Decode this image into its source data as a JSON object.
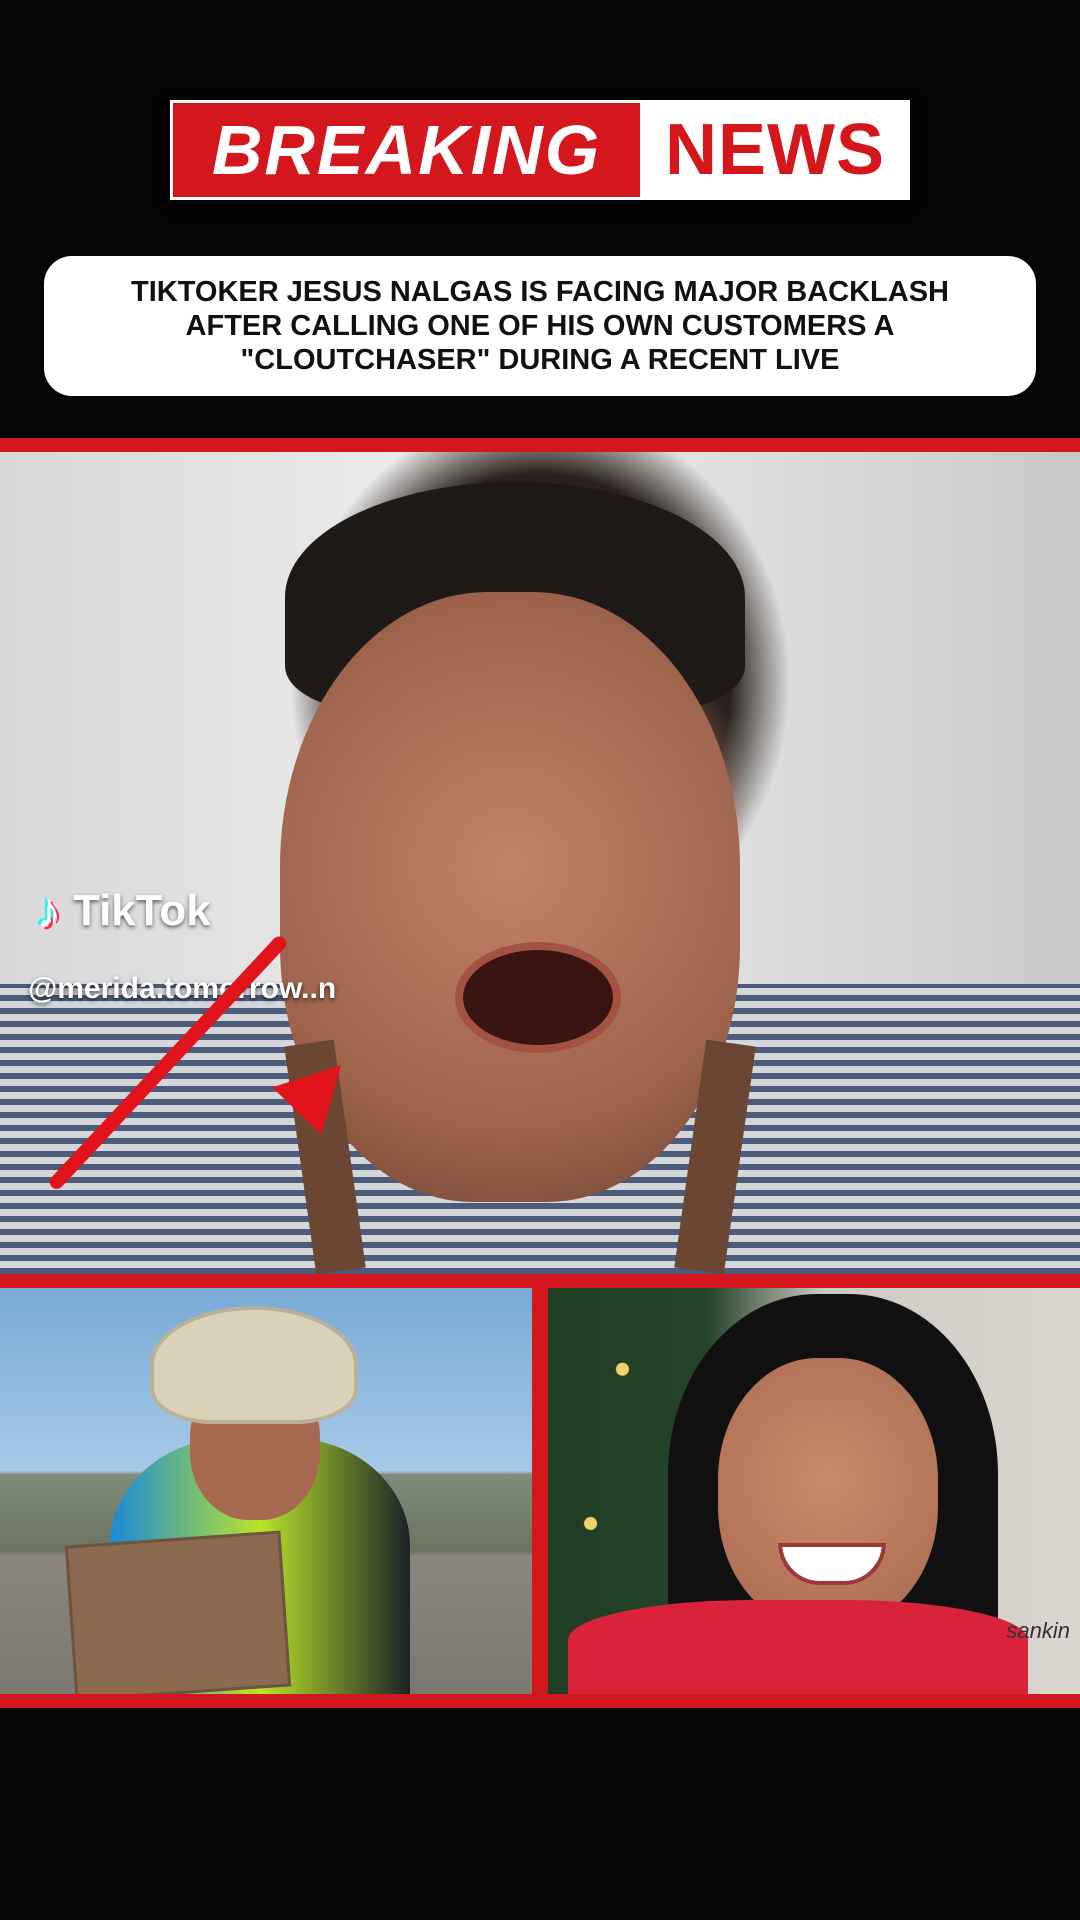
{
  "banner": {
    "left": "BREAKING",
    "right": "NEWS"
  },
  "headline": "TIKTOKER JESUS NALGAS IS FACING MAJOR BACKLASH\nAFTER CALLING ONE OF HIS OWN CUSTOMERS A\n\"CLOUTCHASER\" DURING A RECENT LIVE",
  "watermark": {
    "brand": "TikTok",
    "handle": "@merida.tomorrow..n",
    "icon": "tiktok-icon"
  },
  "clipboard_text": "sankin",
  "colors": {
    "accent": "#d4171c",
    "background": "#050505",
    "white": "#ffffff"
  }
}
